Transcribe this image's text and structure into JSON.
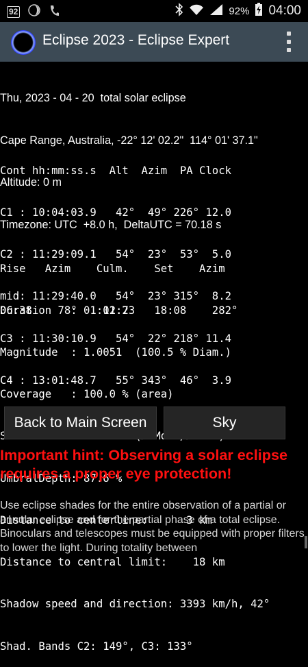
{
  "status_bar": {
    "notification_badge": "92",
    "battery_percent": "92%",
    "time": "04:00"
  },
  "action_bar": {
    "title": "Eclipse 2023 - Eclipse Expert"
  },
  "header": {
    "date_line": "Thu, 2023 - 04 - 20  total solar eclipse",
    "location_line": "Cape Range, Australia, -22° 12' 02.2\"  114° 01' 37.1\"",
    "altitude_line": "Altitude: 0 m",
    "timezone_line": "Timezone: UTC  +8.0 h,  DeltaUTC = 70.18 s"
  },
  "contacts": {
    "header": "Cont hh:mm:ss.s  Alt  Azim  PA Clock",
    "rows": [
      "C1 : 10:04:03.9   42°  49° 226° 12.0",
      "C2 : 11:29:09.1   54°  23°  53°  5.0",
      "mid: 11:29:40.0   54°  23° 315°  8.2",
      "C3 : 11:30:10.9   54°  22° 218° 11.4",
      "C4 : 13:01:48.7   55° 343°  46°  3.9"
    ]
  },
  "sun": {
    "header": "Rise   Azim    Culm.    Set    Azim",
    "values": "06:38    78°    12:23   18:08    282°"
  },
  "details": [
    "Duration   : 01:01.7",
    "Magnitude  : 1.0051  (100.5 % Diam.)",
    "Coverage   : 100.0 % (area)",
    "Size Ratio : 1.0116  (Ø Moon/Ø Sun)",
    "UmbralDepth: 87.6 %",
    "Distance to centerline:      3 km",
    "Distance to central limit:    18 km",
    "Shadow speed and direction: 3393 km/h, 42°",
    "Shad. Bands C2: 149°, C3: 133°"
  ],
  "buttons": {
    "back_label": "Back to Main Screen",
    "sky_label": "Sky"
  },
  "hint": "Important hint: Observing a solar eclipse requires a proper eye protection!",
  "paragraph": "Use eclipse shades for the entire observation of a partial or annular eclipse and for the partial phase of a total eclipse. Binoculars and telescopes must be equipped with proper filters to lower the light. During totality between"
}
